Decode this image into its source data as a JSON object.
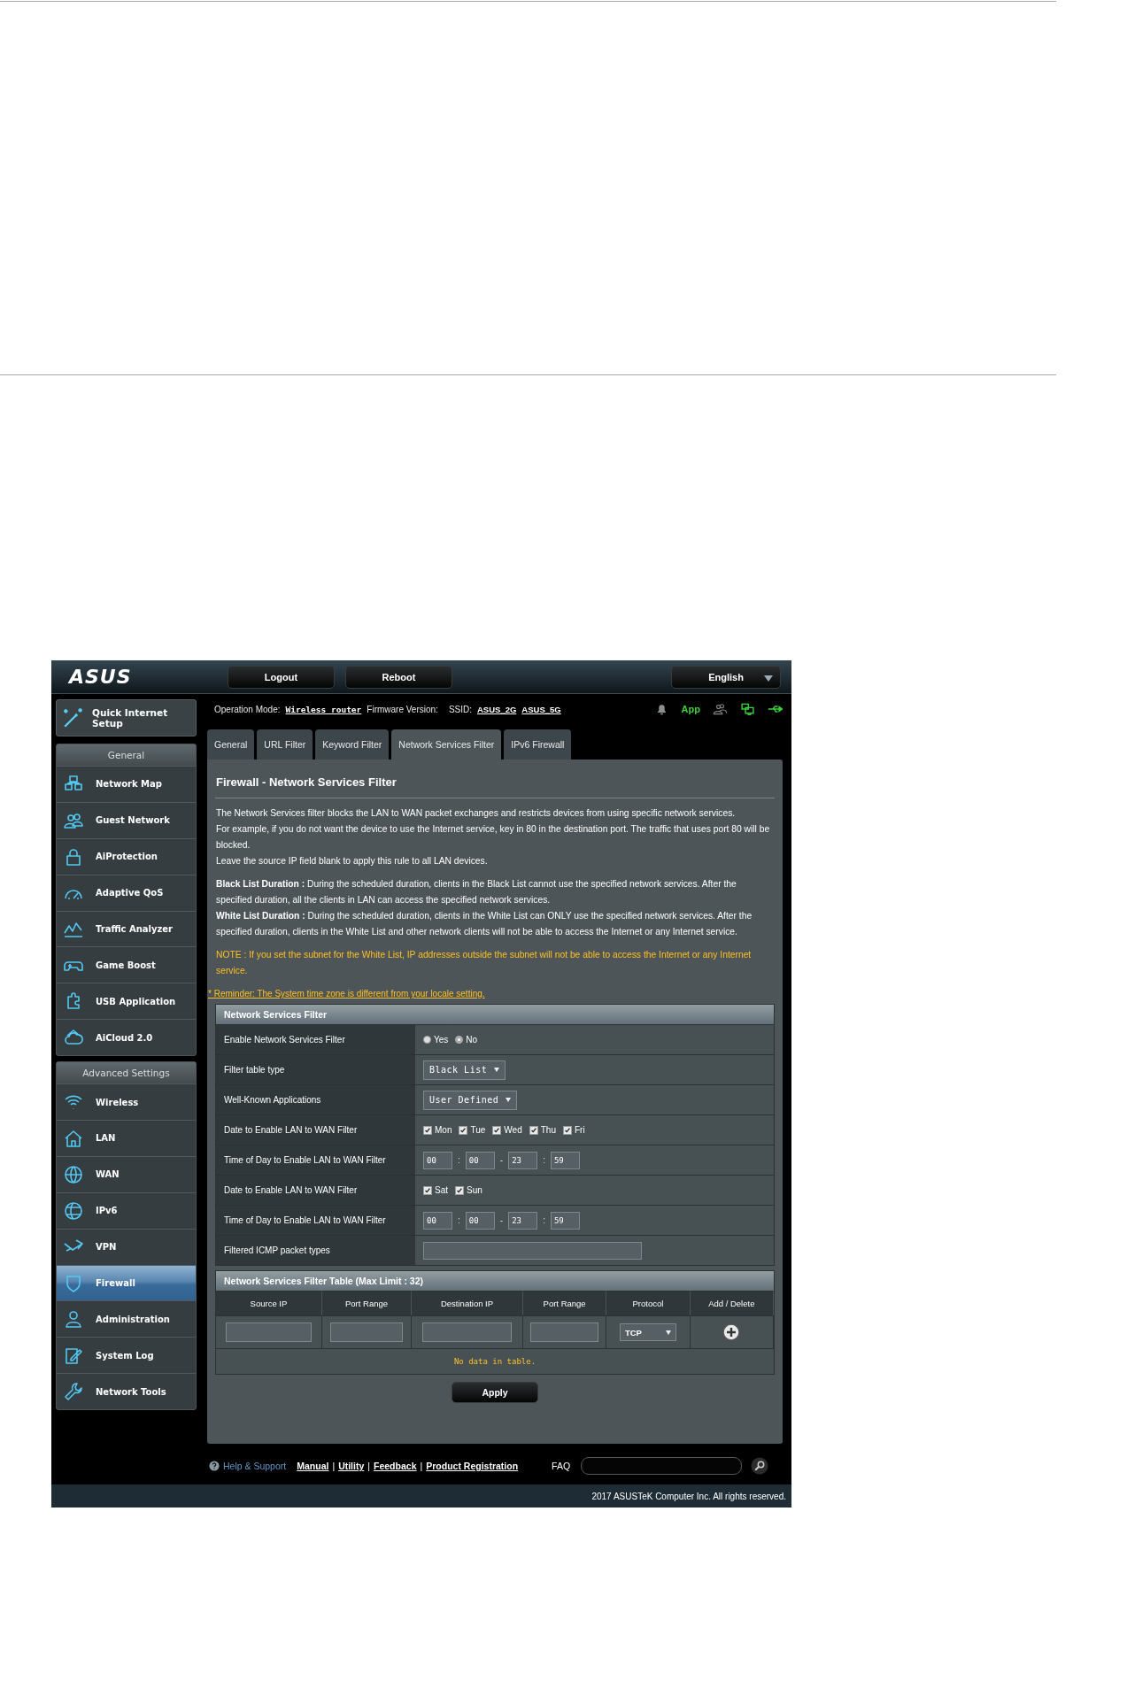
{
  "header": {
    "logo": "ASUS",
    "buttons": [
      "Logout",
      "Reboot"
    ],
    "language": "English"
  },
  "status": {
    "operation_mode_label": "Operation Mode:",
    "operation_mode": "Wireless router",
    "firmware_label": "Firmware Version:",
    "ssid_label": "SSID:",
    "ssids": [
      "ASUS_2G",
      "ASUS_5G"
    ],
    "icons": [
      {
        "kind": "bell",
        "on": false
      },
      {
        "kind": "app",
        "label": "App",
        "on": true
      },
      {
        "kind": "clients",
        "on": false
      },
      {
        "kind": "network",
        "on": true
      },
      {
        "kind": "usb",
        "on": true
      }
    ]
  },
  "sidebar": {
    "quick_setup": "Quick Internet Setup",
    "sections": [
      {
        "title": "General",
        "items": [
          {
            "label": "Network Map",
            "selected": false
          },
          {
            "label": "Guest Network",
            "selected": false
          },
          {
            "label": "AiProtection",
            "selected": false
          },
          {
            "label": "Adaptive QoS",
            "selected": false
          },
          {
            "label": "Traffic Analyzer",
            "selected": false
          },
          {
            "label": "Game Boost",
            "selected": false
          },
          {
            "label": "USB Application",
            "selected": false
          },
          {
            "label": "AiCloud 2.0",
            "selected": false
          }
        ]
      },
      {
        "title": "Advanced Settings",
        "items": [
          {
            "label": "Wireless",
            "selected": false
          },
          {
            "label": "LAN",
            "selected": false
          },
          {
            "label": "WAN",
            "selected": false
          },
          {
            "label": "IPv6",
            "selected": false
          },
          {
            "label": "VPN",
            "selected": false
          },
          {
            "label": "Firewall",
            "selected": true
          },
          {
            "label": "Administration",
            "selected": false
          },
          {
            "label": "System Log",
            "selected": false
          },
          {
            "label": "Network Tools",
            "selected": false
          }
        ]
      }
    ]
  },
  "tabs": [
    {
      "label": "General",
      "selected": false
    },
    {
      "label": "URL Filter",
      "selected": false
    },
    {
      "label": "Keyword Filter",
      "selected": false
    },
    {
      "label": "Network Services Filter",
      "selected": true
    },
    {
      "label": "IPv6 Firewall",
      "selected": false
    }
  ],
  "panel": {
    "title": "Firewall - Network Services Filter",
    "description": [
      [
        {
          "kind": "plain",
          "text": "The Network Services filter blocks the LAN to WAN packet exchanges and restricts devices from using specific network services."
        },
        {
          "kind": "plain",
          "text": "For example, if you do not want the device to use the Internet service, key in 80 in the destination port. The traffic that uses port 80 will be blocked."
        },
        {
          "kind": "plain",
          "text": "Leave the source IP field blank to apply this rule to all LAN devices."
        }
      ],
      [
        {
          "kind": "plain",
          "text": "**Black List Duration :** During the scheduled duration, clients in the Black List cannot use the specified network services. After the specified duration, all the clients in LAN can access the specified network services."
        },
        {
          "kind": "plain",
          "text": "**White List Duration :** During the scheduled duration, clients in the White List can ONLY use the specified network services. After the specified duration, clients in the White List and other network clients will not be able to access the Internet or any Internet service."
        }
      ],
      [
        {
          "kind": "note",
          "text": "NOTE : If you set the subnet for the White List, IP addresses outside the subnet will not be able to access the Internet or any Internet service."
        }
      ]
    ],
    "reminder": "* Reminder: The System time zone is different from your locale setting.",
    "form": {
      "title": "Network Services Filter",
      "rows": [
        {
          "kind": "radio",
          "label": "Enable Network Services Filter",
          "options": [
            {
              "label": "Yes",
              "selected": false
            },
            {
              "label": "No",
              "selected": true
            }
          ]
        },
        {
          "kind": "select",
          "label": "Filter table type",
          "value": "Black List"
        },
        {
          "kind": "select",
          "label": "Well-Known Applications",
          "value": "User Defined"
        },
        {
          "kind": "checkboxes",
          "label": "Date to Enable LAN to WAN Filter",
          "options": [
            {
              "label": "Mon",
              "checked": true
            },
            {
              "label": "Tue",
              "checked": true
            },
            {
              "label": "Wed",
              "checked": true
            },
            {
              "label": "Thu",
              "checked": true
            },
            {
              "label": "Fri",
              "checked": true
            }
          ]
        },
        {
          "kind": "time",
          "label": "Time of Day to Enable LAN to WAN Filter",
          "values": [
            "00",
            "00",
            "23",
            "59"
          ],
          "separators": [
            ":",
            "-",
            ":"
          ]
        },
        {
          "kind": "checkboxes",
          "label": "Date to Enable LAN to WAN Filter",
          "options": [
            {
              "label": "Sat",
              "checked": true
            },
            {
              "label": "Sun",
              "checked": true
            }
          ]
        },
        {
          "kind": "time",
          "label": "Time of Day to Enable LAN to WAN Filter",
          "values": [
            "00",
            "00",
            "23",
            "59"
          ],
          "separators": [
            ":",
            "-",
            ":"
          ]
        },
        {
          "kind": "input",
          "label": "Filtered ICMP packet types"
        }
      ]
    },
    "table": {
      "title": "Network Services Filter Table (Max Limit : 32)",
      "columns": [
        "Source IP",
        "Port Range",
        "Destination IP",
        "Port Range",
        "Protocol",
        "Add / Delete"
      ],
      "protocol": "TCP",
      "empty_message": "No data in table."
    },
    "apply": "Apply"
  },
  "footer": {
    "help": "Help & Support",
    "links": [
      "Manual",
      "Utility",
      "Feedback",
      "Product Registration"
    ],
    "separators": [
      "|",
      "|",
      "|"
    ],
    "faq": "FAQ",
    "copyright": "2017 ASUSTeK Computer Inc. All rights reserved."
  }
}
